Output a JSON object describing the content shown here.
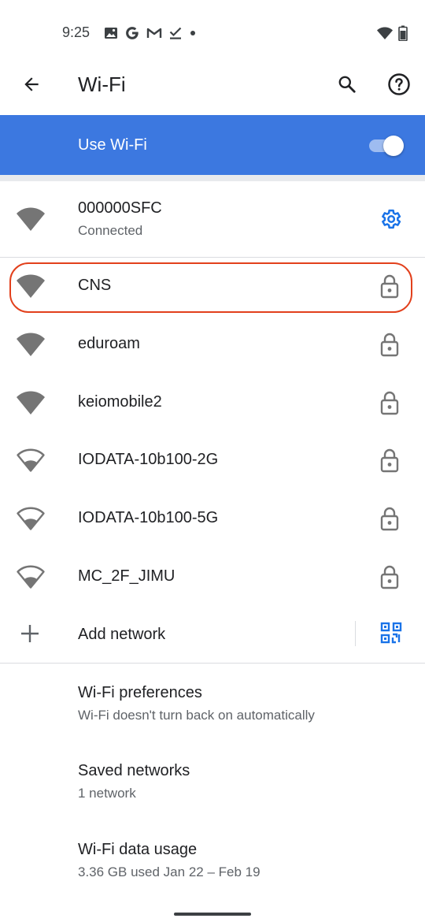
{
  "status_bar": {
    "time": "9:25",
    "left_icons": [
      "photo-icon",
      "google-icon",
      "gmail-icon",
      "download-done-icon",
      "dot-icon"
    ],
    "right_icons": [
      "wifi-icon",
      "battery-icon"
    ]
  },
  "app_bar": {
    "title": "Wi-Fi",
    "back_icon": "arrow-back-icon",
    "search_icon": "search-icon",
    "help_icon": "help-icon"
  },
  "use_wifi": {
    "label": "Use Wi-Fi",
    "enabled": true,
    "background": "#3c78e0"
  },
  "connected_network": {
    "ssid": "000000SFC",
    "status": "Connected",
    "accent": "#1a73e8"
  },
  "networks": [
    {
      "ssid": "CNS",
      "signal": "full",
      "locked": true,
      "highlighted": true
    },
    {
      "ssid": "eduroam",
      "signal": "full",
      "locked": true
    },
    {
      "ssid": "keiomobile2",
      "signal": "full",
      "locked": true
    },
    {
      "ssid": "IODATA-10b100-2G",
      "signal": "weak",
      "locked": true
    },
    {
      "ssid": "IODATA-10b100-5G",
      "signal": "weak",
      "locked": true
    },
    {
      "ssid": "MC_2F_JIMU",
      "signal": "weak",
      "locked": true
    }
  ],
  "add_network": {
    "label": "Add network",
    "qr_icon": "qr-scan-icon"
  },
  "preferences": [
    {
      "title": "Wi-Fi preferences",
      "subtitle": "Wi-Fi doesn't turn back on automatically"
    },
    {
      "title": "Saved networks",
      "subtitle": "1 network"
    },
    {
      "title": "Wi-Fi data usage",
      "subtitle": "3.36 GB used Jan 22 – Feb 19"
    }
  ],
  "colors": {
    "highlight": "#e2401c",
    "icon_gray": "#757575",
    "icon_dark": "#202124"
  }
}
